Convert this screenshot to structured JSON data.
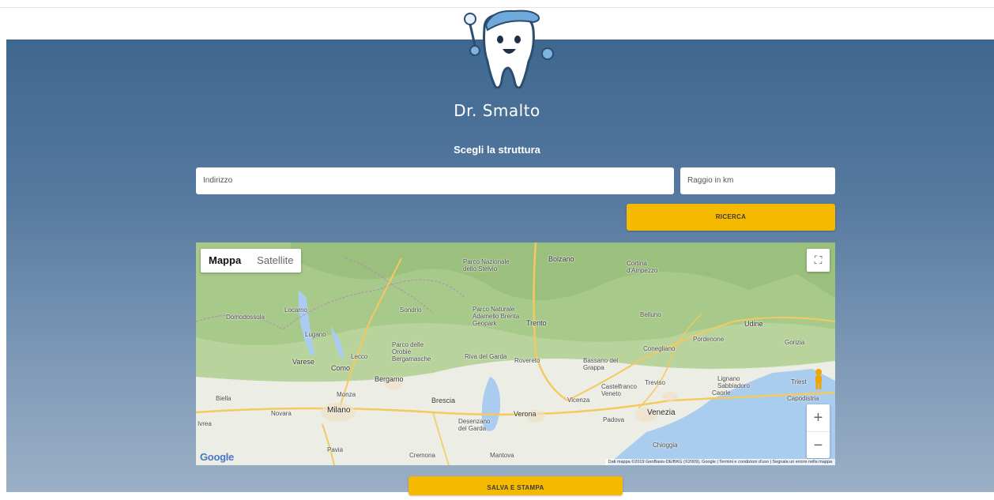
{
  "brand": {
    "name": "Dr. Smalto"
  },
  "form": {
    "title": "Scegli la struttura",
    "address_placeholder": "Indirizzo",
    "radius_placeholder": "Raggio in km",
    "search_label": "RICERCA",
    "save_label": "SALVA E STAMPA"
  },
  "map": {
    "type_map": "Mappa",
    "type_satellite": "Satellite",
    "google_logo": "Google",
    "attribution": "Dati mappa ©2019 GeoBasis-DE/BKG (©2009), Google | Termini e condizioni d'uso | Segnala un errore nella mappa",
    "places": {
      "bolzano": "Bolzano",
      "stelvio": "Parco Nazionale dello Stelvio",
      "cortina": "Cortina d'Ampezzo",
      "adamello": "Parco Naturale Adamello Brenta Geopark",
      "trento": "Trento",
      "belluno": "Belluno",
      "udine": "Udine",
      "pordenone": "Pordenone",
      "gorizia": "Gorizia",
      "lugano": "Lugano",
      "locarno": "Locarno",
      "sondrio": "Sondrio",
      "domodossola": "Domodossola",
      "orobie": "Parco delle Orobie Bergamasche",
      "lecco": "Lecco",
      "como": "Como",
      "varese": "Varese",
      "bergamo": "Bergamo",
      "monza": "Monza",
      "milano": "Milano",
      "brescia": "Brescia",
      "novara": "Novara",
      "biella": "Biella",
      "riva": "Riva del Garda",
      "rovereto": "Rovereto",
      "bassano": "Bassano del Grappa",
      "conegliano": "Conegliano",
      "treviso": "Treviso",
      "castelfranco": "Castelfranco Veneto",
      "vicenza": "Vicenza",
      "padova": "Padova",
      "venezia": "Venezia",
      "verona": "Verona",
      "desenzano": "Desenzano del Garda",
      "mantova": "Mantova",
      "cremona": "Cremona",
      "pavia": "Pavia",
      "chioggia": "Chioggia",
      "lignano": "Lignano Sabbiadoro",
      "caorle": "Caorle",
      "capodistria": "Capodistria",
      "triest": "Triest",
      "ivrea": "Ivrea"
    }
  },
  "colors": {
    "accent": "#f5b900",
    "hero_top": "#3e6790",
    "hero_bottom": "#9bb0c6"
  }
}
